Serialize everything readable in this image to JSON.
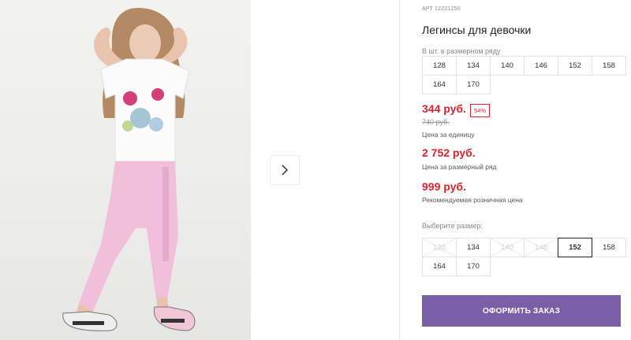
{
  "product": {
    "article": "АРТ 12221250",
    "title": "Легинсы для девочки"
  },
  "size_row": {
    "note": "В шт. в размерном ряду",
    "sizes": [
      "128",
      "134",
      "140",
      "146",
      "152",
      "158",
      "164",
      "170"
    ]
  },
  "prices": {
    "unit_price": "344 руб.",
    "discount_badge": "54%",
    "old_price": "740 руб.",
    "unit_caption": "Цена за единицу",
    "row_price": "2 752 руб.",
    "row_caption": "Цена за размерный ряд",
    "retail_price": "999 руб.",
    "retail_caption": "Рекомендуемая розничная цена",
    "price_color": "#e1202c"
  },
  "size_select": {
    "label": "Выберите размер:",
    "sizes": [
      {
        "label": "128",
        "state": "disabled"
      },
      {
        "label": "134",
        "state": "available"
      },
      {
        "label": "140",
        "state": "disabled"
      },
      {
        "label": "146",
        "state": "disabled"
      },
      {
        "label": "152",
        "state": "selected"
      },
      {
        "label": "158",
        "state": "available"
      },
      {
        "label": "164",
        "state": "available"
      },
      {
        "label": "170",
        "state": "available"
      }
    ]
  },
  "actions": {
    "order_label": "ОФОРМИТЬ ЗАКАЗ",
    "accent_color": "#7a5ea6"
  },
  "gallery": {
    "next_icon": "chevron-right-icon"
  }
}
